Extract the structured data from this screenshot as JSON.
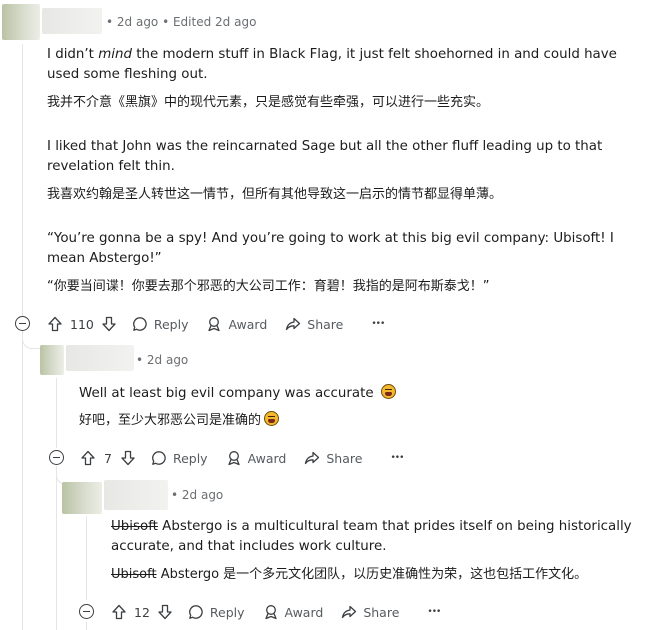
{
  "comment1": {
    "meta": "• 2d ago • Edited 2d ago",
    "para1_a": "I didn’t ",
    "para1_em": "mind",
    "para1_b": " the modern stuff in Black Flag, it just felt shoehorned in and could have used some fleshing out.",
    "para1_cn": "我并不介意《黑旗》中的现代元素，只是感觉有些牵强，可以进行一些充实。",
    "para2": "I liked that John was the reincarnated Sage but all the other fluff leading up to that revelation felt thin.",
    "para2_cn": "我喜欢约翰是圣人转世这一情节，但所有其他导致这一启示的情节都显得单薄。",
    "para3": "“You’re gonna be a spy! And you’re going to work at this big evil company: Ubisoft! I mean Abstergo!”",
    "para3_cn": "“你要当间谍！你要去那个邪恶的大公司工作：育碧！我指的是阿布斯泰戈！”",
    "votes": "110",
    "reply": "Reply",
    "award": "Award",
    "share": "Share",
    "more": "•••"
  },
  "comment2": {
    "meta": "• 2d ago",
    "text": "Well at least big evil company was accurate",
    "text_cn": "好吧，至少大邪恶公司是准确的",
    "votes": "7",
    "reply": "Reply",
    "award": "Award",
    "share": "Share",
    "more": "•••"
  },
  "comment3": {
    "meta": "• 2d ago",
    "strike": "Ubisoft",
    "text": " Abstergo is a multicultural team that prides itself on being historically accurate, and that includes work culture.",
    "strike_cn": "Ubisoft",
    "text_cn": " Abstergo 是一个多元文化团队，以历史准确性为荣，这也包括工作文化。",
    "votes": "12",
    "reply": "Reply",
    "award": "Award",
    "share": "Share",
    "more": "•••"
  },
  "colors": {
    "text": "#1c1c1c",
    "muted": "#6b6f72",
    "line": "#e5e5e5"
  },
  "icons": [
    "upvote-icon",
    "downvote-icon",
    "comment-icon",
    "award-icon",
    "share-icon",
    "more-icon",
    "collapse-icon",
    "emoji-icon"
  ]
}
